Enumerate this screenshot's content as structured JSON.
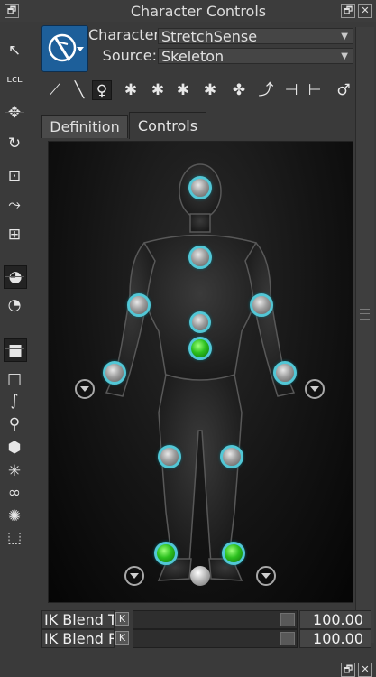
{
  "window": {
    "title": "Character Controls",
    "restore_label": "🗗",
    "close_label": "✕"
  },
  "left_tools": [
    {
      "name": "select-tool",
      "glyph": "↖",
      "selected": false
    },
    {
      "name": "local-tool",
      "glyph": "ʟᴄʟ",
      "selected": false
    },
    {
      "name": "translate-tool",
      "glyph": "✥",
      "selected": false
    },
    {
      "name": "rotate-tool",
      "glyph": "↻",
      "selected": false
    },
    {
      "name": "scale-tool",
      "glyph": "⊡",
      "selected": false
    },
    {
      "name": "transform-tool",
      "glyph": "⤳",
      "selected": false
    },
    {
      "name": "move-axis-tool",
      "glyph": "⊞",
      "selected": false
    },
    {
      "name": "globe-select-tool",
      "glyph": "◕",
      "selected": true
    },
    {
      "name": "globe-move-tool",
      "glyph": "◔",
      "selected": false
    },
    {
      "name": "cube-dark-tool",
      "glyph": "■",
      "selected": true
    },
    {
      "name": "cube-tool",
      "glyph": "□",
      "selected": false
    },
    {
      "name": "path-tool",
      "glyph": "∫",
      "selected": false
    },
    {
      "name": "pin-tool",
      "glyph": "⚲",
      "selected": false
    },
    {
      "name": "hexagon-tool",
      "glyph": "⬢",
      "selected": false
    },
    {
      "name": "joint-tool",
      "glyph": "✳",
      "selected": false
    },
    {
      "name": "chain-tool",
      "glyph": "∞",
      "selected": false
    },
    {
      "name": "light-tool",
      "glyph": "✺",
      "selected": false
    },
    {
      "name": "bounding-box-tool",
      "glyph": "⬚",
      "selected": false
    }
  ],
  "character": {
    "character_label": "Character:",
    "character_value": "StretchSense",
    "source_label": "Source:",
    "source_value": "Skeleton"
  },
  "toolbar": [
    {
      "name": "bones-tool",
      "glyph": "⟋"
    },
    {
      "name": "stick-tool",
      "glyph": "╲"
    },
    {
      "name": "stick-figure-selected-tool",
      "glyph": "♀",
      "selected": true
    },
    {
      "name": "full-body-tool",
      "glyph": "✱"
    },
    {
      "name": "body-part-tool",
      "glyph": "✱"
    },
    {
      "name": "selection-tool",
      "glyph": "✱"
    },
    {
      "name": "ghost-tool",
      "glyph": "✱"
    },
    {
      "name": "pin-translate-tool",
      "glyph": "✤"
    },
    {
      "name": "pin-rotate-tool",
      "glyph": "⤴"
    },
    {
      "name": "pull-tool",
      "glyph": "⊣"
    },
    {
      "name": "release-tool",
      "glyph": "⊢"
    },
    {
      "name": "pose-tool",
      "glyph": "♂"
    }
  ],
  "tabs": {
    "definition": "Definition",
    "controls": "Controls"
  },
  "controls": {
    "nodes": {
      "head": "head",
      "chest": "chest",
      "left_shoulder": "left shoulder",
      "right_shoulder": "right shoulder",
      "waist": "waist",
      "hips": "hips",
      "left_wrist": "left wrist",
      "right_wrist": "right wrist",
      "left_knee": "left knee",
      "right_knee": "right knee",
      "left_ankle": "left ankle",
      "right_ankle": "right ankle",
      "ground": "ground"
    }
  },
  "properties": [
    {
      "label": "IK Blend T",
      "key": "K",
      "value": "100.00",
      "anim": "A"
    },
    {
      "label": "IK Blend R",
      "key": "K",
      "value": "100.00",
      "anim": "A"
    }
  ],
  "colors": {
    "node_outline": "#52c7d6",
    "ik_node": "#2cc01e",
    "logo_bg": "#1d5f9a"
  }
}
